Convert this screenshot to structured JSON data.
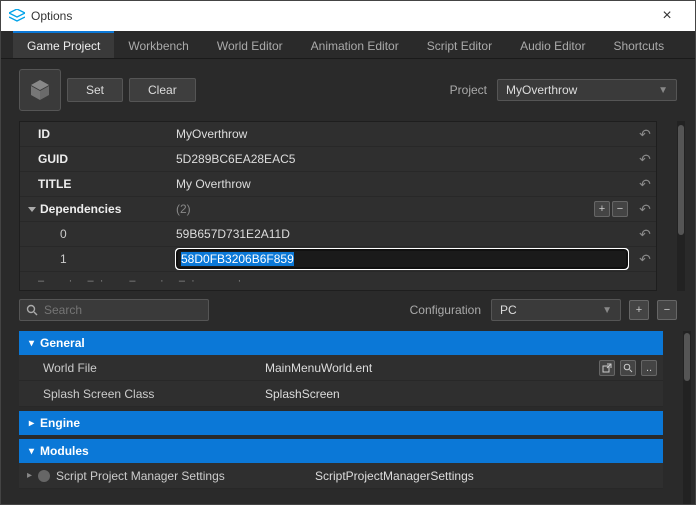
{
  "window": {
    "title": "Options"
  },
  "tabs": [
    "Game Project",
    "Workbench",
    "World Editor",
    "Animation Editor",
    "Script Editor",
    "Audio Editor",
    "Shortcuts"
  ],
  "active_tab": 0,
  "toolbar": {
    "set": "Set",
    "clear": "Clear",
    "project_label": "Project",
    "project_value": "MyOverthrow"
  },
  "fields": {
    "id": {
      "label": "ID",
      "value": "MyOverthrow"
    },
    "guid": {
      "label": "GUID",
      "value": "5D289BC6EA28EAC5"
    },
    "title": {
      "label": "TITLE",
      "value": "My Overthrow"
    },
    "deps": {
      "label": "Dependencies",
      "count": "(2)"
    },
    "dep0": {
      "label": "0",
      "value": "59B657D731E2A11D"
    },
    "dep1": {
      "label": "1",
      "value": "58D0FB3206B6F859"
    }
  },
  "search": {
    "placeholder": "Search",
    "config_label": "Configuration",
    "config_value": "PC"
  },
  "sections": {
    "general": {
      "title": "General",
      "world_file": {
        "label": "World File",
        "value": "MainMenuWorld.ent"
      },
      "splash": {
        "label": "Splash Screen Class",
        "value": "SplashScreen"
      }
    },
    "engine": {
      "title": "Engine"
    },
    "modules": {
      "title": "Modules",
      "spm": {
        "label": "Script Project Manager Settings",
        "value": "ScriptProjectManagerSettings"
      }
    }
  }
}
